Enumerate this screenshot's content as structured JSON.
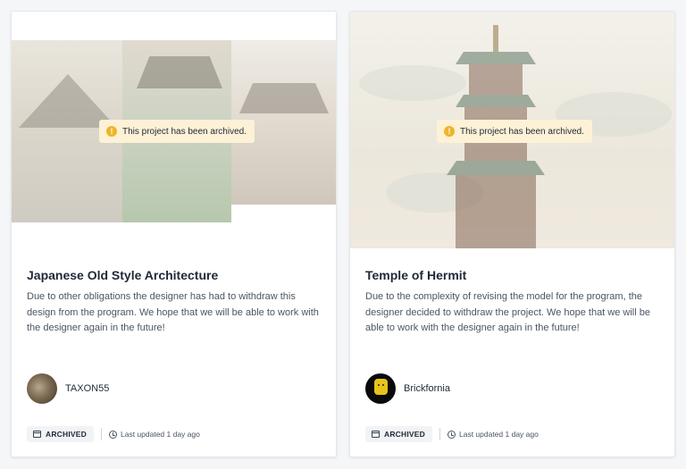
{
  "cards": [
    {
      "title": "Japanese Old Style Architecture",
      "description": "Due to other obligations the designer has had to withdraw this design from the program. We hope that we will be able to work with the designer again in the future!",
      "banner": "This project has been archived.",
      "author": "TAXON55",
      "status_badge": "ARCHIVED",
      "last_updated": "Last updated 1 day ago"
    },
    {
      "title": "Temple of Hermit",
      "description": "Due to the complexity of revising the model for the program, the designer decided to withdraw the project. We hope that we will be able to work with the designer again in the future!",
      "banner": "This project has been archived.",
      "author": "Brickfornia",
      "status_badge": "ARCHIVED",
      "last_updated": "Last updated 1 day ago"
    }
  ],
  "colors": {
    "banner_bg": "#fdf1d6",
    "warning": "#f0b429",
    "badge_bg": "#f1f3f5",
    "text": "#1f2937"
  },
  "icons": {
    "banner": "warning-icon",
    "badge": "archive-box-icon",
    "updated": "clock-history-icon"
  }
}
